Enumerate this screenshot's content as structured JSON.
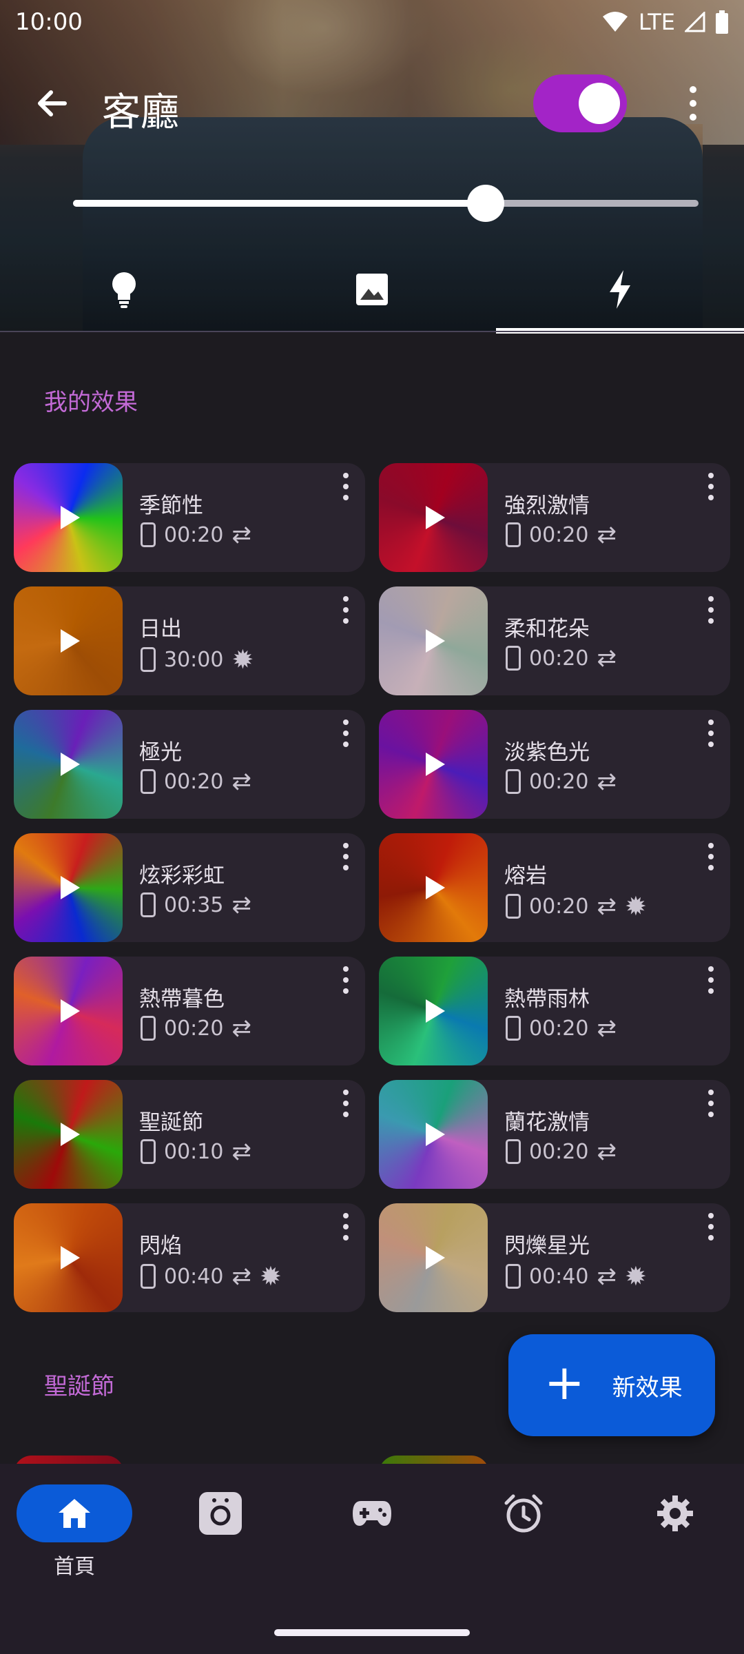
{
  "status_bar": {
    "time": "10:00",
    "network": "LTE"
  },
  "header": {
    "room_name": "客廳",
    "power_on": true,
    "brightness_fraction": 0.66
  },
  "tabs": [
    {
      "name": "lights",
      "icon": "bulb-icon"
    },
    {
      "name": "scenes",
      "icon": "image-icon"
    },
    {
      "name": "effects",
      "icon": "lightning-icon",
      "selected": true
    }
  ],
  "sections": {
    "my_effects": "我的效果",
    "christmas": "聖誕節"
  },
  "effects": [
    {
      "name": "季節性",
      "duration": "00:20",
      "mode": "repeat",
      "colors": [
        "#0b2cf0",
        "#22c21a",
        "#c9c216",
        "#ff3a5a",
        "#8a2be2"
      ]
    },
    {
      "name": "強烈激情",
      "duration": "00:20",
      "mode": "repeat",
      "colors": [
        "#a3001f",
        "#6e0d3a",
        "#c4102a",
        "#8a0a2a"
      ]
    },
    {
      "name": "日出",
      "duration": "30:00",
      "mode": "brightness",
      "colors": [
        "#b35b00",
        "#9e4d05",
        "#c46a10"
      ]
    },
    {
      "name": "柔和花朵",
      "duration": "00:20",
      "mode": "repeat",
      "colors": [
        "#b8a79e",
        "#8fa89a",
        "#c7b0b8",
        "#a29bb3"
      ]
    },
    {
      "name": "極光",
      "duration": "00:20",
      "mode": "repeat",
      "colors": [
        "#6a1fb8",
        "#2aa890",
        "#3d7a2a",
        "#1f6b9b"
      ]
    },
    {
      "name": "淡紫色光",
      "duration": "00:20",
      "mode": "repeat",
      "colors": [
        "#9a0f7a",
        "#4b1cb8",
        "#c01a6a",
        "#6a12a0"
      ]
    },
    {
      "name": "炫彩彩虹",
      "duration": "00:35",
      "mode": "repeat",
      "colors": [
        "#c81e1e",
        "#2ea818",
        "#0a2ad0",
        "#7a0fb0",
        "#e07a10"
      ]
    },
    {
      "name": "熔岩",
      "duration": "00:20",
      "mode": "repeat+brightness",
      "colors": [
        "#c01c0a",
        "#e27a0a",
        "#8e1a06"
      ]
    },
    {
      "name": "熱帶暮色",
      "duration": "00:20",
      "mode": "repeat",
      "colors": [
        "#7a1fc0",
        "#d62a5a",
        "#b01aa0",
        "#e0602a"
      ]
    },
    {
      "name": "熱帶雨林",
      "duration": "00:20",
      "mode": "repeat",
      "colors": [
        "#1fa03a",
        "#0a7ab0",
        "#2ac07a",
        "#156b3a"
      ]
    },
    {
      "name": "聖誕節",
      "duration": "00:10",
      "mode": "repeat",
      "colors": [
        "#c01a1a",
        "#2aa80a",
        "#9e0a0a",
        "#1a7a0a"
      ]
    },
    {
      "name": "蘭花激情",
      "duration": "00:20",
      "mode": "repeat",
      "colors": [
        "#1aa07a",
        "#c060c0",
        "#7a3ac0",
        "#3a9ab0"
      ]
    },
    {
      "name": "閃焰",
      "duration": "00:40",
      "mode": "repeat+brightness",
      "colors": [
        "#c04a0a",
        "#9e2a0a",
        "#e07a1a"
      ]
    },
    {
      "name": "閃爍星光",
      "duration": "00:40",
      "mode": "repeat+brightness",
      "colors": [
        "#b8a060",
        "#c0a880",
        "#9a9a9a",
        "#c0907a"
      ]
    }
  ],
  "fab": {
    "label": "新效果"
  },
  "bottom_nav": [
    {
      "name": "home",
      "label": "首頁",
      "icon": "home-icon",
      "active": true
    },
    {
      "name": "camera",
      "label": "",
      "icon": "camera-icon"
    },
    {
      "name": "games",
      "label": "",
      "icon": "gamepad-icon"
    },
    {
      "name": "alarms",
      "label": "",
      "icon": "alarm-icon"
    },
    {
      "name": "settings",
      "label": "",
      "icon": "settings-icon"
    }
  ],
  "colors": {
    "accent": "#a324c7",
    "primary": "#0b5bd8",
    "section_title": "#c36ad6",
    "card_bg": "#2a242f"
  }
}
